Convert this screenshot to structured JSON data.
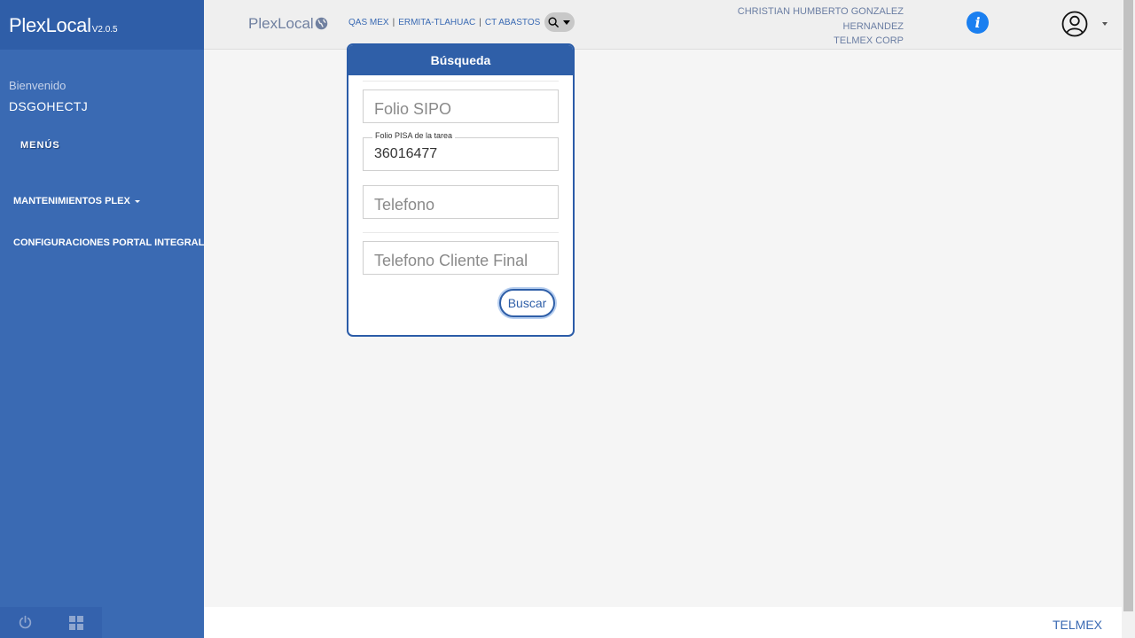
{
  "sidebar": {
    "brand": "PlexLocal",
    "version": "V2.0.5",
    "welcome": "Bienvenido",
    "username": "DSGOHECTJ",
    "menus_title": "MENÚS",
    "items": [
      {
        "label": "MANTENIMIENTOS PLEX"
      },
      {
        "label": "CONFIGURACIONES PORTAL INTEGRAL"
      }
    ]
  },
  "topbar": {
    "brand": "PlexLocal",
    "crumbs": [
      "QAS MEX",
      "ERMITA-TLAHUAC",
      "CT ABASTOS"
    ],
    "user_name_line1": "CHRISTIAN HUMBERTO GONZALEZ",
    "user_name_line2": "HERNANDEZ",
    "company": "TELMEX CORP",
    "info_glyph": "i"
  },
  "search_panel": {
    "title": "Búsqueda",
    "folio_sipo": {
      "placeholder": "Folio SIPO",
      "value": ""
    },
    "folio_pisa": {
      "label": "Folio PISA de la tarea",
      "value": "36016477"
    },
    "telefono": {
      "placeholder": "Telefono",
      "value": ""
    },
    "telefono_cliente": {
      "placeholder": "Telefono Cliente Final",
      "value": ""
    },
    "button": "Buscar"
  },
  "footer": {
    "text": "TELMEX"
  },
  "colors": {
    "primary": "#3a6ab3",
    "header": "#2f5fa8",
    "info": "#1a7ff0"
  },
  "icons": [
    "globe-icon",
    "search-icon",
    "info-icon",
    "user-avatar-icon",
    "power-icon",
    "grid-icon"
  ]
}
